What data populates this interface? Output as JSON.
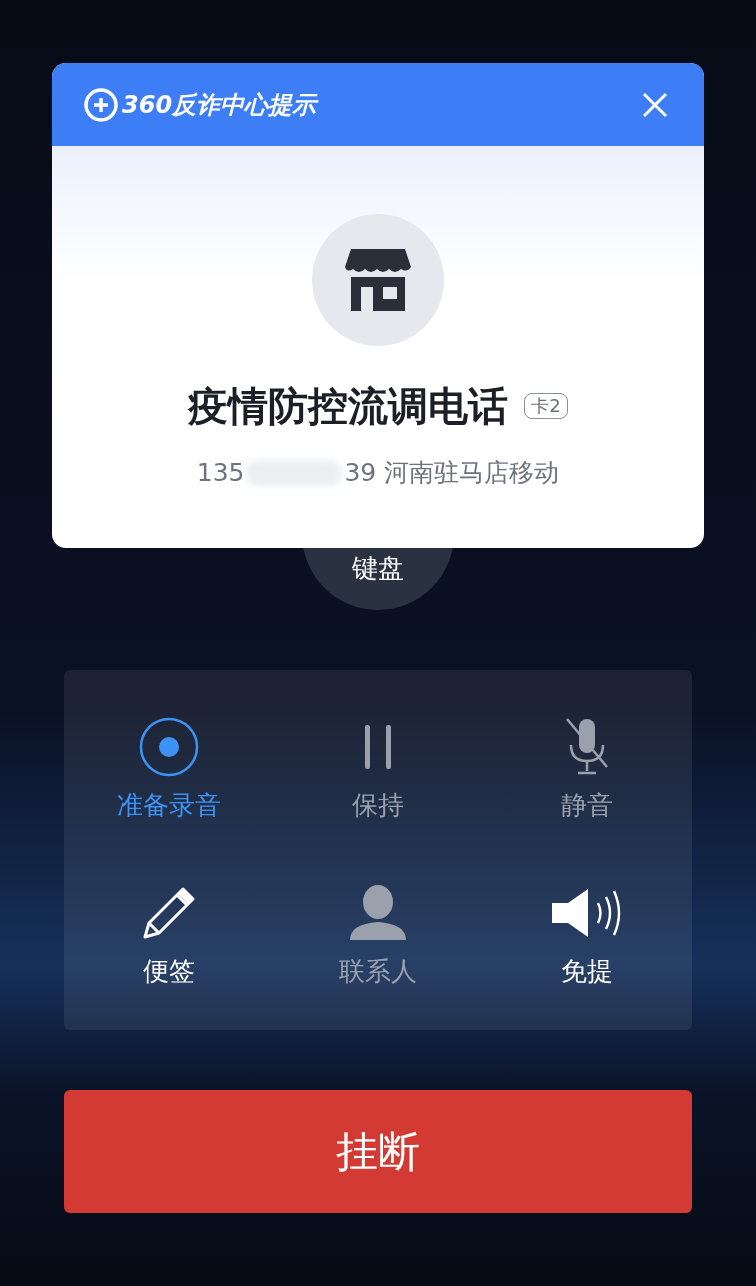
{
  "alert": {
    "title": "360反诈中心提示",
    "caller_name": "疫情防控流调电话",
    "sim_badge": "卡2",
    "number_start": "135",
    "number_end": "39",
    "location": "河南驻马店移动"
  },
  "keypad_button": {
    "label": "键盘"
  },
  "controls": [
    {
      "kind": "record",
      "label": "准备录音",
      "active": true,
      "disabled": false
    },
    {
      "kind": "hold",
      "label": "保持",
      "active": false,
      "disabled": true
    },
    {
      "kind": "mute",
      "label": "静音",
      "active": false,
      "disabled": true
    },
    {
      "kind": "note",
      "label": "便签",
      "active": false,
      "disabled": false
    },
    {
      "kind": "contacts",
      "label": "联系人",
      "active": false,
      "disabled": true
    },
    {
      "kind": "speaker",
      "label": "免提",
      "active": false,
      "disabled": false
    }
  ],
  "hangup_button": {
    "label": "挂断"
  }
}
